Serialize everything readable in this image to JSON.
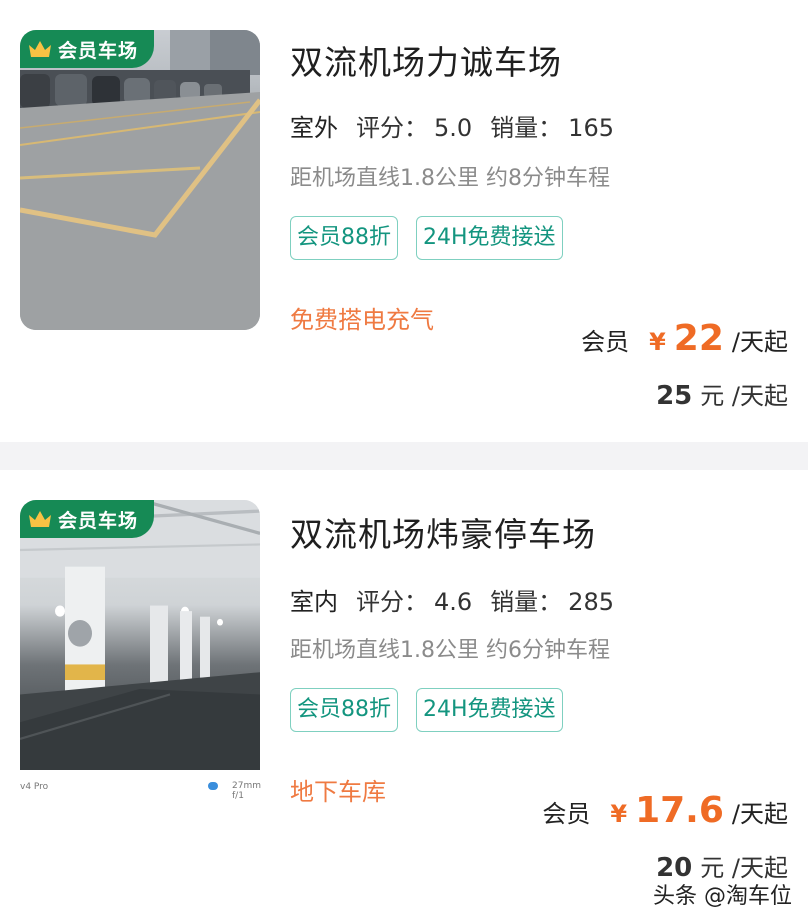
{
  "listings": [
    {
      "badge": "会员车场",
      "title": "双流机场力诚车场",
      "environment": "室外",
      "rating_label": "评分：",
      "rating": "5.0",
      "sales_label": "销量：",
      "sales": "165",
      "distance": "距机场直线1.8公里 约8分钟车程",
      "tags": [
        "会员88折",
        "24H免费接送"
      ],
      "feature": "免费搭电充气",
      "member_label": "会员",
      "currency": "¥",
      "member_price": "22",
      "price_unit": "/天起",
      "original_price": "25",
      "original_unit": "元 /天起"
    },
    {
      "badge": "会员车场",
      "title": "双流机场炜豪停车场",
      "environment": "室内",
      "rating_label": "评分：",
      "rating": "4.6",
      "sales_label": "销量：",
      "sales": "285",
      "distance": "距机场直线1.8公里 约6分钟车程",
      "tags": [
        "会员88折",
        "24H免费接送"
      ],
      "feature": "地下车库",
      "member_label": "会员",
      "currency": "¥",
      "member_price": "17.6",
      "price_unit": "/天起",
      "original_price": "20",
      "original_unit": "元 /天起",
      "photo_caption_left": "v4 Pro",
      "photo_caption_right": "27mm f/1"
    }
  ],
  "watermark": "头条 @淘车位",
  "colors": {
    "badge_green": "#168a55",
    "price_orange": "#ef6b25",
    "feature_orange": "#ef7a42",
    "tag_teal": "#13957f",
    "env_highlight": "#3cc18a"
  }
}
